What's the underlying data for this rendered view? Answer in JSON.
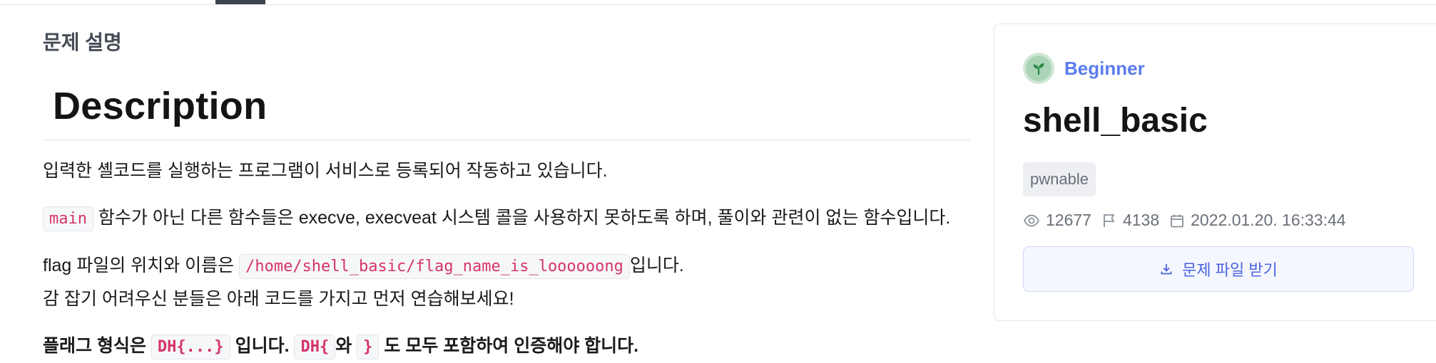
{
  "header": {
    "active_tab_indicator": true
  },
  "problem": {
    "section_label": "문제 설명",
    "heading": "Description",
    "para1": "입력한 셸코드를 실행하는 프로그램이 서비스로 등록되어 작동하고 있습니다.",
    "para2": {
      "code": "main",
      "text": " 함수가 아닌 다른 함수들은 execve, execveat 시스템 콜을 사용하지 못하도록 하며, 풀이와 관련이 없는 함수입니다."
    },
    "para3": {
      "prefix": "flag 파일의 위치와 이름은 ",
      "code": "/home/shell_basic/flag_name_is_loooooong",
      "suffix": "입니다."
    },
    "para4": "감 잡기 어려우신 분들은 아래 코드를 가지고 먼저 연습해보세요!",
    "para5": {
      "prefix": "플래그 형식은 ",
      "code1": "DH{...}",
      "mid1": " 입니다. ",
      "code2": "DH{",
      "mid2": "와 ",
      "code3": "}",
      "suffix": " 도 모두 포함하여 인증해야 합니다."
    }
  },
  "sidebar": {
    "level": {
      "label": "Beginner",
      "icon": "sprout-icon",
      "color": "#5b7cf0"
    },
    "title": "shell_basic",
    "tag": "pwnable",
    "stats": {
      "views": "12677",
      "solves": "4138",
      "date": "2022.01.20. 16:33:44"
    },
    "download_label": "문제 파일 받기"
  }
}
